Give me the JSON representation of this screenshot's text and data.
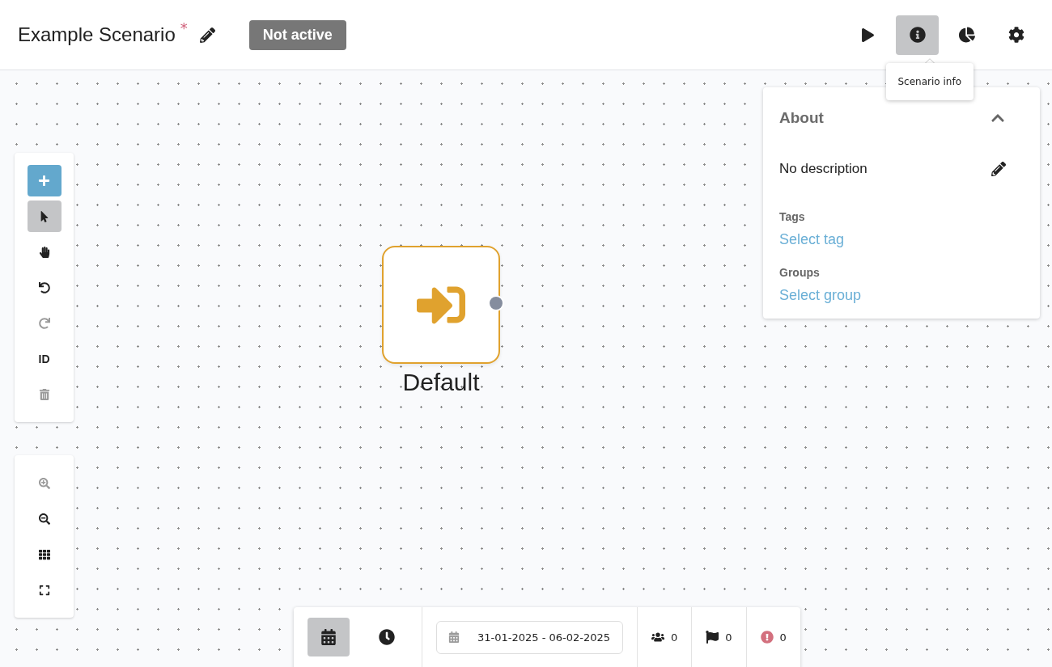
{
  "header": {
    "title": "Example Scenario",
    "unsaved_mark": "*",
    "status": "Not active",
    "actions": [
      {
        "kind": "run",
        "selected": false
      },
      {
        "kind": "info",
        "selected": true
      },
      {
        "kind": "stats",
        "selected": false
      },
      {
        "kind": "settings",
        "selected": false
      }
    ],
    "tooltip": "Scenario info"
  },
  "edit_tools": [
    {
      "kind": "add",
      "selected": false,
      "disabled": false
    },
    {
      "kind": "select",
      "selected": true,
      "disabled": false
    },
    {
      "kind": "pan",
      "selected": false,
      "disabled": false
    },
    {
      "kind": "undo",
      "selected": false,
      "disabled": false
    },
    {
      "kind": "redo",
      "selected": false,
      "disabled": true
    },
    {
      "kind": "id",
      "label": "ID",
      "selected": false,
      "disabled": false
    },
    {
      "kind": "delete",
      "selected": false,
      "disabled": true
    }
  ],
  "view_tools": [
    {
      "kind": "zoom_in",
      "disabled": true
    },
    {
      "kind": "zoom_out",
      "disabled": false
    },
    {
      "kind": "grid",
      "disabled": false
    },
    {
      "kind": "fit",
      "disabled": false
    }
  ],
  "node": {
    "label": "Default"
  },
  "info_panel": {
    "title": "About",
    "expanded": true,
    "description": "No description",
    "sections": [
      {
        "label": "Tags",
        "link": "Select tag"
      },
      {
        "label": "Groups",
        "link": "Select group"
      }
    ]
  },
  "bottom_bar": {
    "modes": [
      {
        "kind": "calendar",
        "selected": true
      },
      {
        "kind": "clock",
        "selected": false
      }
    ],
    "date_range": "31-01-2025 - 06-02-2025",
    "counters": [
      {
        "kind": "people",
        "value": "0"
      },
      {
        "kind": "flag",
        "value": "0"
      },
      {
        "kind": "alert",
        "value": "0"
      }
    ]
  }
}
